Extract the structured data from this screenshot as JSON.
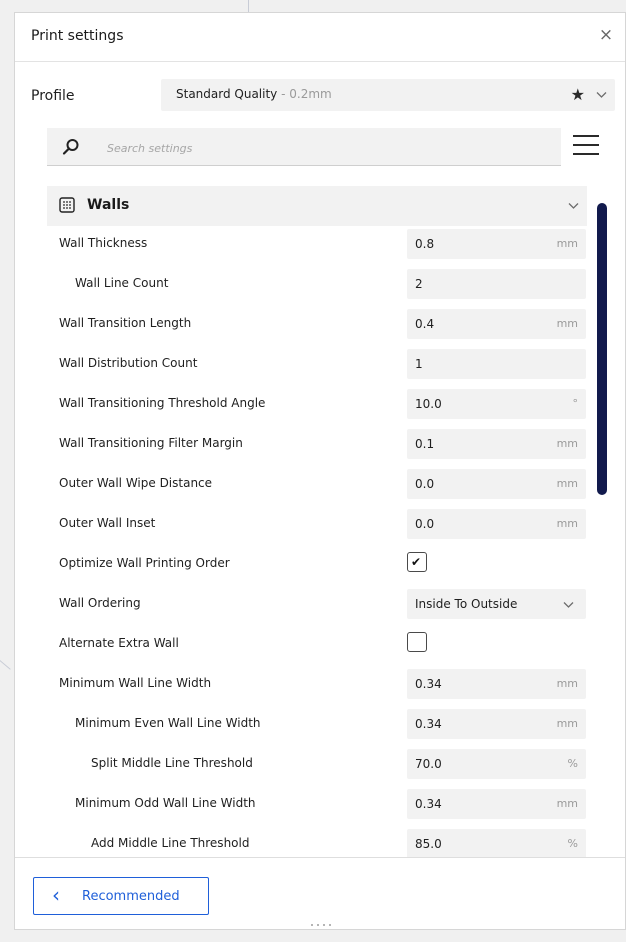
{
  "panel": {
    "title": "Print settings",
    "close_glyph": "×"
  },
  "profile": {
    "label": "Profile",
    "name": "Standard Quality",
    "sub": " - 0.2mm",
    "favorite_icon": "star-icon",
    "expand_icon": "chevron-down-icon"
  },
  "search": {
    "placeholder": "Search settings",
    "value": "",
    "icon": "search-icon",
    "menu_icon": "hamburger-menu-icon"
  },
  "category": {
    "label": "Walls",
    "icon": "walls-icon",
    "collapse_icon": "chevron-down-icon"
  },
  "settings": [
    {
      "label": "Wall Thickness",
      "value": "0.8",
      "unit": "mm"
    },
    {
      "label": "Wall Line Count",
      "value": "2",
      "unit": ""
    },
    {
      "label": "Wall Transition Length",
      "value": "0.4",
      "unit": "mm"
    },
    {
      "label": "Wall Distribution Count",
      "value": "1",
      "unit": ""
    },
    {
      "label": "Wall Transitioning Threshold Angle",
      "value": "10.0",
      "unit": "°"
    },
    {
      "label": "Wall Transitioning Filter Margin",
      "value": "0.1",
      "unit": "mm"
    },
    {
      "label": "Outer Wall Wipe Distance",
      "value": "0.0",
      "unit": "mm"
    },
    {
      "label": "Outer Wall Inset",
      "value": "0.0",
      "unit": "mm"
    },
    {
      "label": "Optimize Wall Printing Order",
      "checked": true,
      "check_glyph": "✔"
    },
    {
      "label": "Wall Ordering",
      "value": "Inside To Outside"
    },
    {
      "label": "Alternate Extra Wall",
      "checked": false
    },
    {
      "label": "Minimum Wall Line Width",
      "value": "0.34",
      "unit": "mm"
    },
    {
      "label": "Minimum Even Wall Line Width",
      "value": "0.34",
      "unit": "mm"
    },
    {
      "label": "Split Middle Line Threshold",
      "value": "70.0",
      "unit": "%"
    },
    {
      "label": "Minimum Odd Wall Line Width",
      "value": "0.34",
      "unit": "mm"
    },
    {
      "label": "Add Middle Line Threshold",
      "value": "85.0",
      "unit": "%"
    }
  ],
  "footer": {
    "recommended_label": "Recommended",
    "back_glyph": "‹"
  },
  "colors": {
    "accent": "#1f5fd9",
    "scrollbar": "#121a4d",
    "field_bg": "#f2f2f2"
  }
}
